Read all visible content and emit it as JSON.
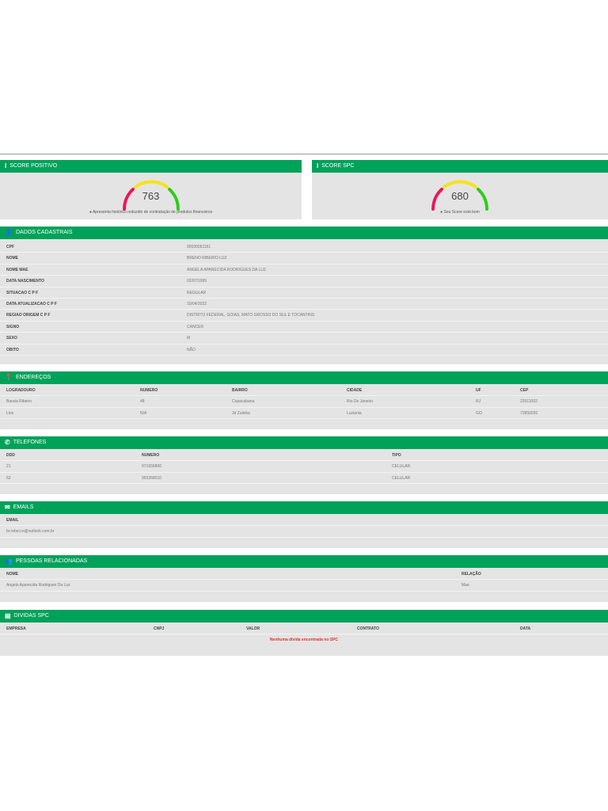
{
  "scores": [
    {
      "title": "SCORE POSITIVO",
      "value": "763",
      "note": "Apresenta histórico reduzido de contratação de produtos financeiros"
    },
    {
      "title": "SCORE SPC",
      "value": "680",
      "note": "Seu Score está bom"
    }
  ],
  "colors": {
    "brand": "#00a25a",
    "red": "#e8175d",
    "yellow": "#f5e31c",
    "green": "#2ecc1a"
  },
  "dados": {
    "title": "DADOS CADASTRAIS",
    "rows": [
      {
        "k": "CPF",
        "v": "90030051161"
      },
      {
        "k": "NOME",
        "v": "BRENO RIBEIRO LUZ"
      },
      {
        "k": "NOME MAE",
        "v": "ANGELA APARECIDA RODRIGUES DA LUZ"
      },
      {
        "k": "DATA NASCIMENTO",
        "v": "02/07/1999"
      },
      {
        "k": "SITUACAO C P F",
        "v": "REGULAR"
      },
      {
        "k": "DATA ATUALIZACAO C P F",
        "v": "10/04/2022"
      },
      {
        "k": "REGIAO ORIGEM C P F",
        "v": "DISTRITO FEDERAL, GOIAS, MATO GROSSO DO SUL E TOCANTINS"
      },
      {
        "k": "SIGNO",
        "v": "CANCER"
      },
      {
        "k": "SEXO",
        "v": "M"
      },
      {
        "k": "OBITO",
        "v": "NÃO"
      }
    ]
  },
  "enderecos": {
    "title": "ENDEREÇOS",
    "headers": [
      "LOGRADOURO",
      "NUMERO",
      "BAIRRO",
      "CIDADE",
      "UF",
      "CEP"
    ],
    "rows": [
      [
        "Barata Ribeiro",
        "48",
        "Copacabana",
        "Rio De Janeiro",
        "RJ",
        "22011002"
      ],
      [
        "Lins",
        "N/A",
        "Jd Zuleika",
        "Luziania",
        "GO",
        "72850030"
      ]
    ]
  },
  "telefones": {
    "title": "TELEFONES",
    "headers": [
      "DDD",
      "NUMERO",
      "TIPO"
    ],
    "rows": [
      [
        "21",
        "971656866",
        "CELULAR"
      ],
      [
        "62",
        "993268010",
        "CELULAR"
      ]
    ]
  },
  "emails": {
    "title": "EMAILS",
    "headers": [
      "EMAIL"
    ],
    "rows": [
      [
        "br.rebel.ro@outlook.com.br"
      ]
    ]
  },
  "pessoas": {
    "title": "PESSOAS RELACIONADAS",
    "headers": [
      "NOME",
      "RELAÇÃO"
    ],
    "rows": [
      [
        "Angela Aparecida Rodrigues Da Luz",
        "Mae"
      ]
    ]
  },
  "dividas": {
    "title": "DIVIDAS SPC",
    "headers": [
      "EMPRESA",
      "CNPJ",
      "VALOR",
      "CONTRATO",
      "DATA"
    ],
    "empty": "Nenhuma dívida encontrada no SPC"
  }
}
